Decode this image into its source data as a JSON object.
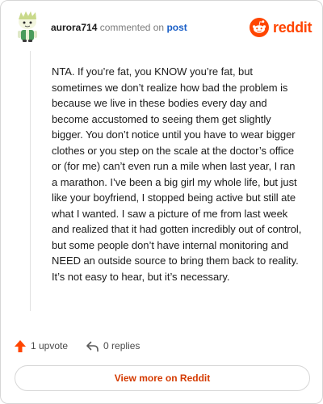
{
  "header": {
    "username": "aurora714",
    "commented_text": "commented on",
    "post_link": "post",
    "brand_name": "reddit",
    "brand_icon": "reddit-alien-icon"
  },
  "comment": {
    "body": "NTA. If you’re fat, you KNOW you’re fat, but sometimes we don’t realize how bad the problem is because we live in these bodies every day and become accustomed to seeing them get slightly bigger. You don’t notice until you have to wear bigger clothes or you step on the scale at the doctor’s office or (for me) can’t even run a mile when last year, I ran a marathon. I’ve been a big girl my whole life, but just like your boyfriend, I stopped being active but still ate what I wanted. I saw a picture of me from last week and realized that it had gotten incredibly out of control, but some people don’t have internal monitoring and NEED an outside source to bring them back to reality. It’s not easy to hear, but it’s necessary."
  },
  "actions": {
    "upvote_label": "1 upvote",
    "upvote_icon": "upvote-arrow-icon",
    "replies_label": "0 replies",
    "reply_icon": "reply-arrow-icon"
  },
  "footer": {
    "view_more_label": "View more on Reddit"
  },
  "colors": {
    "brand": "#ff4500",
    "upvote": "#ff4500",
    "link": "#1a5fc7",
    "view_more_text": "#d43a00"
  }
}
